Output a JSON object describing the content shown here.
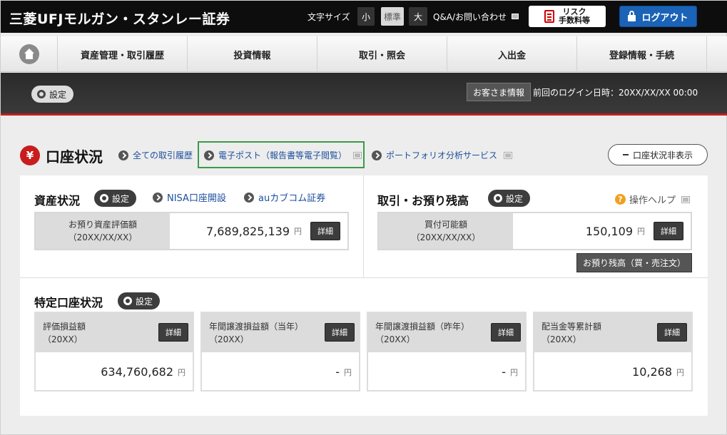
{
  "header": {
    "logo": "三菱UFJモルガン・スタンレー証券",
    "font_size_label": "文字サイズ",
    "font_sizes": [
      "小",
      "標準",
      "大"
    ],
    "qa_label": "Q&A/お問い合わせ",
    "risk_line1": "リスク",
    "risk_line2": "手数料等",
    "logout_label": "ログアウト"
  },
  "nav": {
    "items": [
      "資産管理・取引履歴",
      "投資情報",
      "取引・照会",
      "入出金",
      "登録情報・手続"
    ]
  },
  "band": {
    "settings_label": "設定",
    "customer_info_label": "お客さま情報",
    "last_login": "前回のログイン日時：20XX/XX/XX 00:00"
  },
  "account": {
    "yen_symbol": "¥",
    "title": "口座状況",
    "link_all_history": "全ての取引履歴",
    "link_e_post": "電子ポスト（報告書等電子閲覧）",
    "link_portfolio": "ポートフォリオ分析サービス",
    "hide_label": "口座状況非表示"
  },
  "assets": {
    "title": "資産状況",
    "settings_label": "設定",
    "link_nisa": "NISA口座開設",
    "link_au": "auカブコム証券",
    "label_line1": "お預り資産評価額",
    "label_line2": "（20XX/XX/XX）",
    "value": "7,689,825,139",
    "unit": "円",
    "detail_label": "詳細"
  },
  "trading": {
    "title": "取引・お預り残高",
    "settings_label": "設定",
    "help_label": "操作ヘルプ",
    "label_line1": "買付可能額",
    "label_line2": "（20XX/XX/XX）",
    "value": "150,109",
    "unit": "円",
    "detail_label": "詳細",
    "orders_button": "お預り残高（買・売注文）"
  },
  "specific": {
    "title": "特定口座状況",
    "settings_label": "設定",
    "cards": [
      {
        "label_line1": "評価損益額",
        "label_line2": "（20XX）",
        "value": "634,760,682",
        "unit": "円",
        "detail_label": "詳細"
      },
      {
        "label_line1": "年間譲渡損益額（当年）",
        "label_line2": "（20XX）",
        "value": "-",
        "unit": "円",
        "detail_label": "詳細"
      },
      {
        "label_line1": "年間譲渡損益額（昨年）",
        "label_line2": "（20XX）",
        "value": "-",
        "unit": "円",
        "detail_label": "詳細"
      },
      {
        "label_line1": "配当金等累計額",
        "label_line2": "（20XX）",
        "value": "10,268",
        "unit": "円",
        "detail_label": "詳細"
      }
    ]
  },
  "colors": {
    "header_bg": "#0d0d0d",
    "logout_blue": "#1a63b7",
    "accent_red": "#c81d1d",
    "link_blue": "#1c4f9c",
    "highlight_green": "#3a9a4a"
  },
  "icons": [
    "home-icon",
    "gear-icon",
    "arrow-circle-icon",
    "external-window-icon",
    "lock-icon",
    "document-icon",
    "help-icon",
    "yen-icon",
    "minus-icon"
  ]
}
